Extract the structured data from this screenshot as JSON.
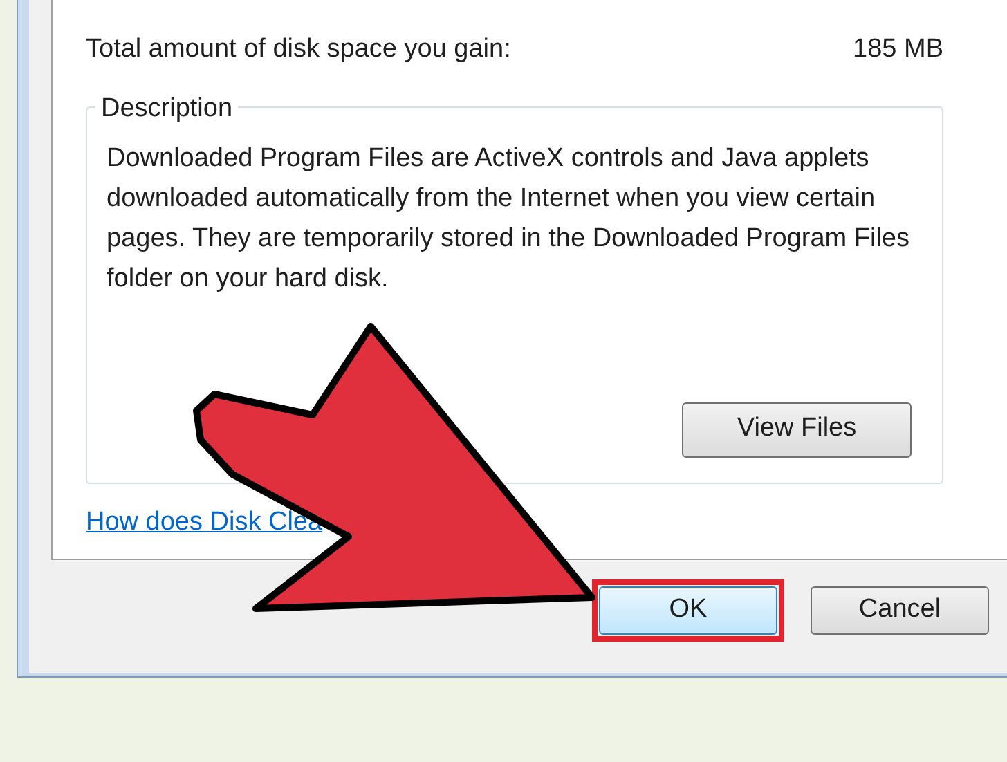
{
  "summary": {
    "label": "Total amount of disk space you gain:",
    "value": "185 MB"
  },
  "description": {
    "title": "Description",
    "text": "Downloaded Program Files are ActiveX controls and Java applets downloaded automatically from the Internet when you view certain pages. They are temporarily stored in the Downloaded Program Files folder on your hard disk.",
    "button": "View Files"
  },
  "help_link": "How does Disk Clea",
  "buttons": [
    {
      "label": "OK",
      "highlighted": true
    },
    {
      "label": "Cancel",
      "highlighted": false
    }
  ]
}
